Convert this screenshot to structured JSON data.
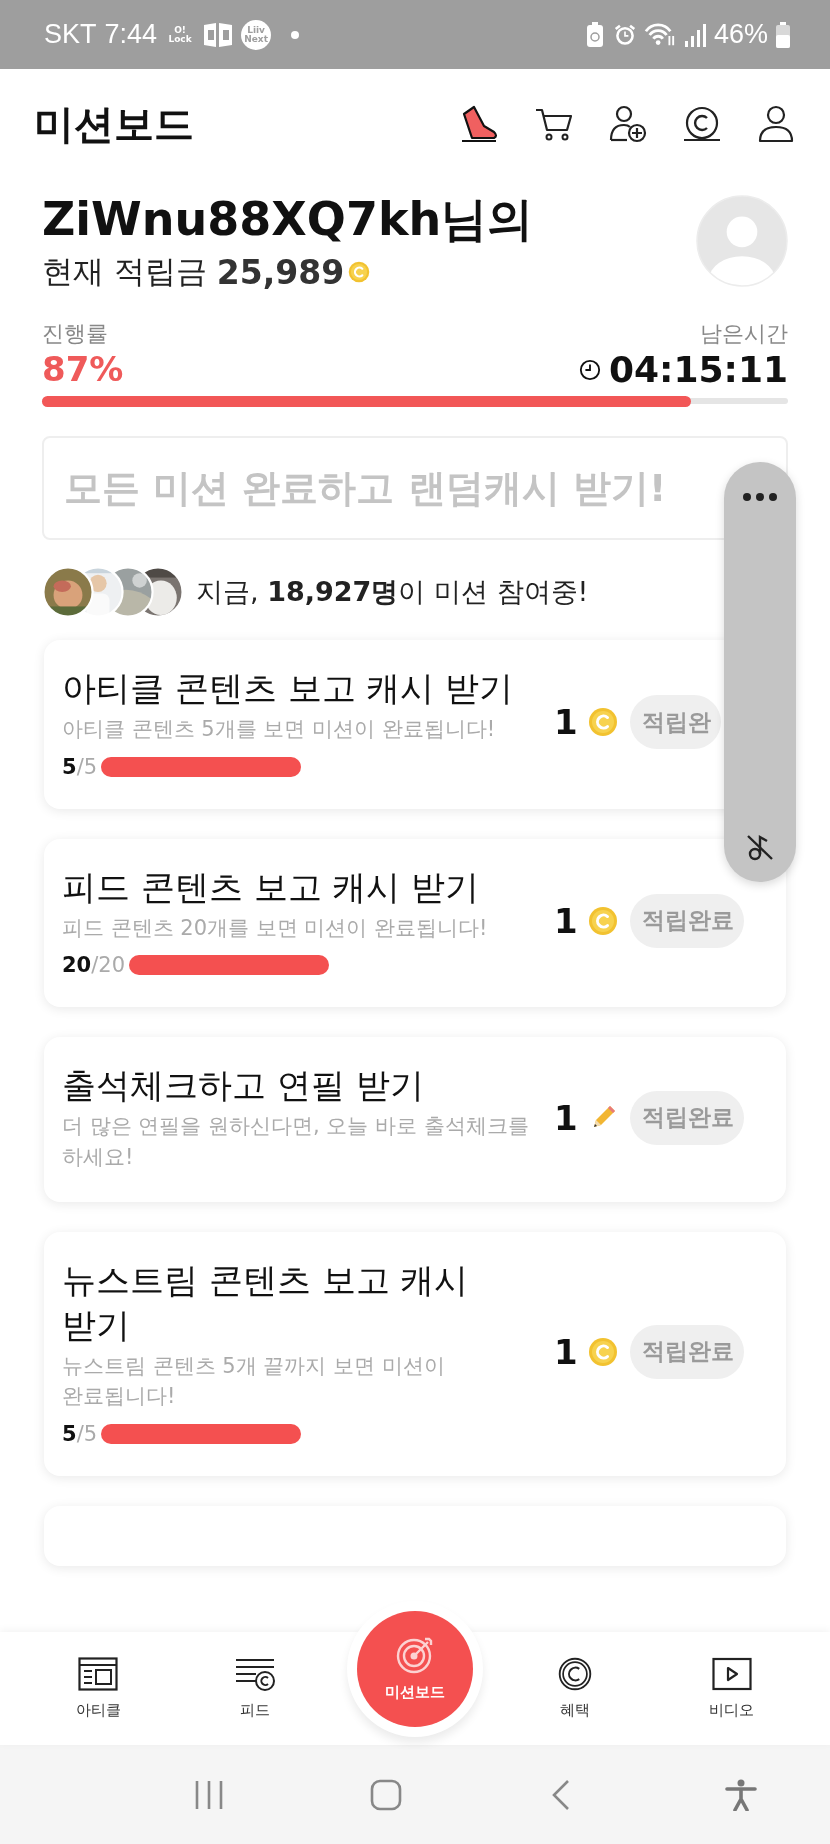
{
  "status_bar": {
    "carrier": "SKT",
    "time": "7:44",
    "notification_icons": [
      {
        "kind": "badge",
        "lines": [
          "O!",
          "Lock"
        ]
      },
      {
        "kind": "cc"
      },
      {
        "kind": "badge",
        "lines": [
          "Liiv",
          "Next"
        ]
      },
      {
        "kind": "dot"
      }
    ],
    "battery": "46%"
  },
  "header": {
    "title": "미션보드"
  },
  "profile": {
    "name": "ZiWnu88XQ7kh님의",
    "balance_label": "현재 적립금",
    "balance": "25,989"
  },
  "progress": {
    "label": "진행률",
    "value": "87%",
    "level": 0.87,
    "time_label": "남은시간",
    "time": "04:15:11"
  },
  "banner": {
    "text": "모든 미션 완료하고 랜덤캐시 받기!",
    "disabled": true
  },
  "participants": {
    "text": "지금, **18,927명**이 미션 참여중!"
  },
  "missions": [
    {
      "title": "아티클 콘텐츠 보고 캐시 받기",
      "description": "아티클 콘텐츠 5개를 보면 미션이 완료됩니다!",
      "done": "5",
      "total": "/5",
      "reward": "1",
      "kind": "coin",
      "button": "적립완",
      "completed": true
    },
    {
      "title": "피드 콘텐츠 보고 캐시 받기",
      "description": "피드 콘텐츠 20개를 보면 미션이 완료됩니다!",
      "done": "20",
      "total": "/20",
      "reward": "1",
      "kind": "coin",
      "button": "적립완료",
      "completed": true
    },
    {
      "title": "출석체크하고 연필 받기",
      "description": "더 많은 연필을 원하신다면, 오늘 바로 출석체크를 하세요!",
      "reward": "1",
      "kind": "pencil",
      "button": "적립완료",
      "completed": true
    },
    {
      "title": "뉴스트림 콘텐츠 보고 캐시 받기",
      "description": "뉴스트림 콘텐츠 5개 끝까지 보면 미션이 완료됩니다!",
      "done": "5",
      "total": "/5",
      "reward": "1",
      "kind": "coin",
      "button": "적립완료",
      "completed": true
    }
  ],
  "bottom_nav": [
    {
      "label": "아티클",
      "kind": "article",
      "selected": false
    },
    {
      "label": "피드",
      "kind": "feed",
      "selected": false
    },
    {
      "label": "미션보드",
      "kind": "mission",
      "selected": true
    },
    {
      "label": "혜택",
      "kind": "benefit",
      "selected": false
    },
    {
      "label": "비디오",
      "kind": "video",
      "selected": false
    }
  ]
}
